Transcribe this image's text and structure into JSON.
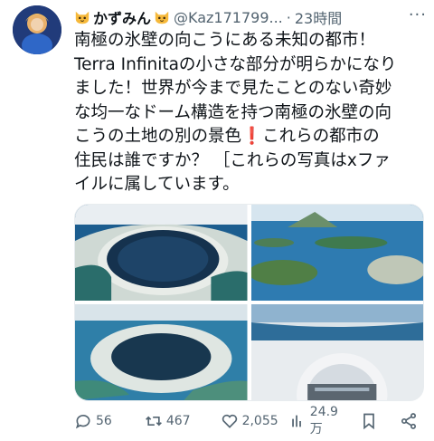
{
  "author": {
    "display_name": "かずみん",
    "handle": "@Kaz171799...",
    "time_separator": "·",
    "timestamp": "23時間",
    "badge_icon": "cat-emoji-icon"
  },
  "more_label": "···",
  "tweet_text_lines": [
    "南極の氷壁の向こうにある未知の都市！",
    "Terra Infinitaの小さな部分が明らかになり",
    "ました！世界が今まで見たことのない奇妙",
    "な均一なドーム構造を持つ南極の氷壁の向",
    "こうの土地の別の景色",
    "住民は誰ですか？ ［これらの写真はxファ",
    "イルに属しています。"
  ],
  "tweet_text_line5_suffix": "これらの都市の",
  "red_mark": "❗",
  "photos": [
    {
      "alt": "aerial-dome-city-1"
    },
    {
      "alt": "aerial-islands-coast"
    },
    {
      "alt": "aerial-dome-city-2"
    },
    {
      "alt": "snow-dome-structure"
    }
  ],
  "metrics": {
    "replies": "56",
    "reposts": "467",
    "likes": "2,055",
    "views": "24.9万"
  },
  "colors": {
    "text": "#0f1419",
    "secondary": "#536471",
    "alert_red": "#e0245e"
  }
}
